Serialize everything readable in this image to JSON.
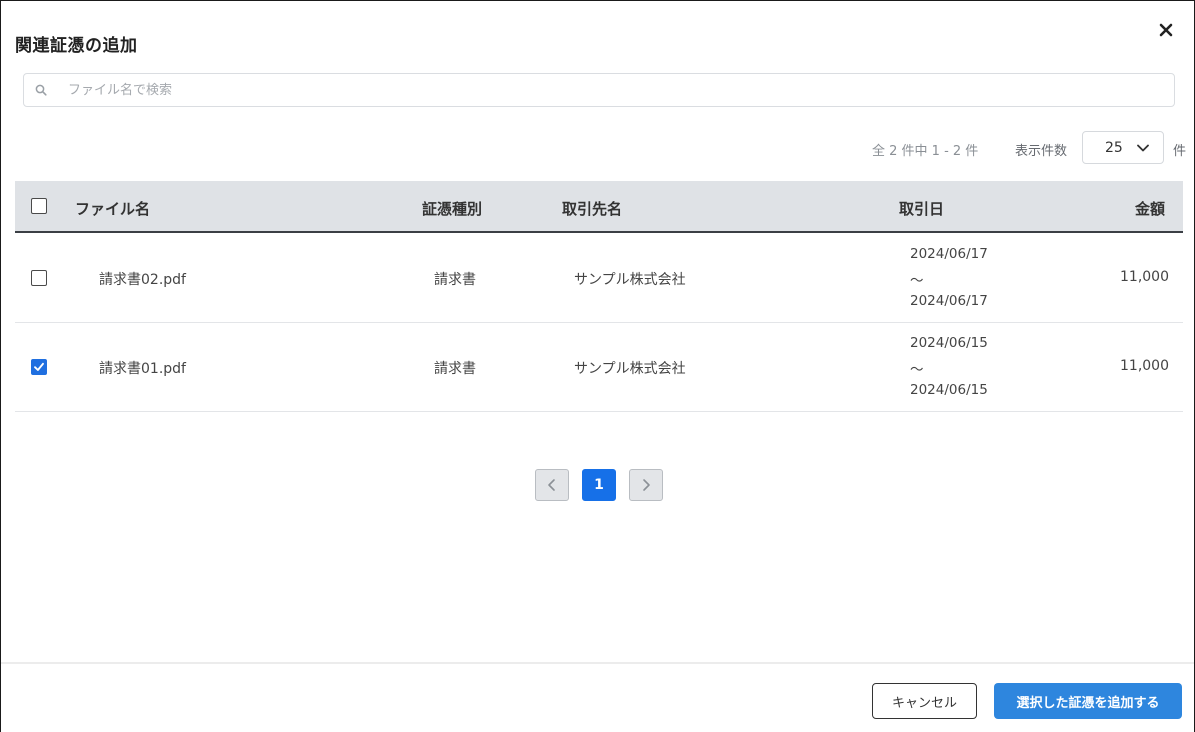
{
  "dialog": {
    "title": "関連証憑の追加"
  },
  "search": {
    "placeholder": "ファイル名で検索",
    "value": ""
  },
  "pagination_info": {
    "count_text": "全 2 件中 1 - 2 件",
    "per_page_label": "表示件数",
    "per_page_value": "25",
    "per_page_unit": "件"
  },
  "table": {
    "columns": [
      "ファイル名",
      "証憑種別",
      "取引先名",
      "取引日",
      "金額"
    ],
    "rows": [
      {
        "checked": false,
        "file_name": "請求書02.pdf",
        "type": "請求書",
        "partner": "サンプル株式会社",
        "date_from": "2024/06/17",
        "date_sep": "〜",
        "date_to": "2024/06/17",
        "amount": "11,000"
      },
      {
        "checked": true,
        "file_name": "請求書01.pdf",
        "type": "請求書",
        "partner": "サンプル株式会社",
        "date_from": "2024/06/15",
        "date_sep": "〜",
        "date_to": "2024/06/15",
        "amount": "11,000"
      }
    ]
  },
  "pager": {
    "current_page": "1"
  },
  "footer": {
    "cancel_label": "キャンセル",
    "submit_label": "選択した証憑を追加する"
  },
  "icons": {
    "close": "close-icon",
    "search": "search-icon",
    "chevron": "chevron-down-icon",
    "prev": "chevron-left-icon",
    "next": "chevron-right-icon",
    "check": "check-icon"
  },
  "colors": {
    "accent": "#1670e8",
    "primary_button": "#2e86de",
    "header_bg": "#dfe2e6"
  }
}
